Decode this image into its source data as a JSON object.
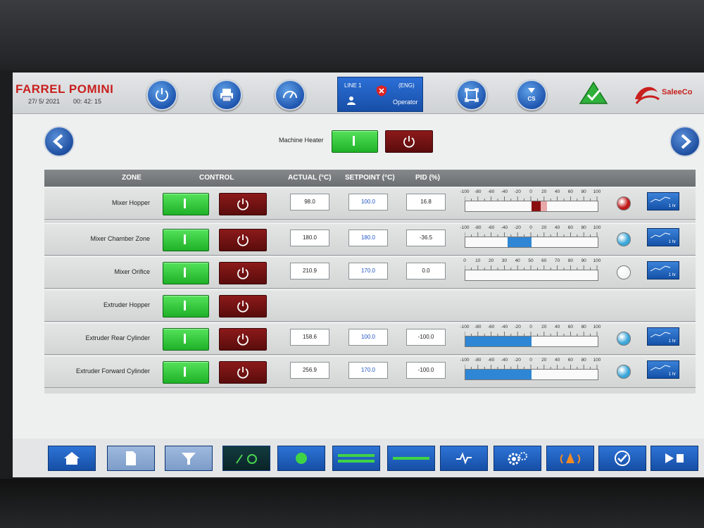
{
  "header": {
    "brand": "FARREL POMINI",
    "date": "27/ 5/ 2021",
    "time": "00: 42: 15",
    "user_panel": {
      "line": "LINE 1",
      "language": "(ENG)",
      "role": "Operator"
    },
    "logo_text": "SaleeCo"
  },
  "heater": {
    "label": "Machine Heater"
  },
  "table": {
    "headers": {
      "zone": "ZONE",
      "control": "CONTROL",
      "actual": "ACTUAL (°C)",
      "setpoint": "SETPOINT (°C)",
      "pid": "PID (%)"
    },
    "rows": [
      {
        "zone": "Mixer Hopper",
        "actual": "98.0",
        "setpoint": "100.0",
        "pid": "16.8",
        "scale_labels": [
          "-100",
          "-80",
          "-60",
          "-40",
          "-20",
          "0",
          "20",
          "40",
          "60",
          "80",
          "100"
        ],
        "scale_min": -100,
        "scale_max": 100,
        "bar_value": 16.8,
        "bar_color": "#8a1010",
        "indicator_color": "#c01818"
      },
      {
        "zone": "Mixer Chamber Zone",
        "actual": "180.0",
        "setpoint": "180.0",
        "pid": "-36.5",
        "scale_labels": [
          "-100",
          "-80",
          "-60",
          "-40",
          "-20",
          "0",
          "20",
          "40",
          "60",
          "80",
          "100"
        ],
        "scale_min": -100,
        "scale_max": 100,
        "bar_value": -36.5,
        "bar_color": "#2f86d4",
        "indicator_color": "#3aa6d8"
      },
      {
        "zone": "Mixer Orifice",
        "actual": "210.9",
        "setpoint": "170.0",
        "pid": "0.0",
        "scale_labels": [
          "0",
          "10",
          "20",
          "30",
          "40",
          "50",
          "60",
          "70",
          "80",
          "90",
          "100"
        ],
        "scale_min": 0,
        "scale_max": 100,
        "bar_value": 0.0,
        "bar_color": "#2f86d4",
        "indicator_color": "#f4f4f4"
      },
      {
        "zone": "Extruder Hopper"
      },
      {
        "zone": "Extruder Rear Cylinder",
        "actual": "158.6",
        "setpoint": "100.0",
        "pid": "-100.0",
        "scale_labels": [
          "-100",
          "-80",
          "-60",
          "-40",
          "-20",
          "0",
          "20",
          "40",
          "60",
          "80",
          "100"
        ],
        "scale_min": -100,
        "scale_max": 100,
        "bar_value": -100,
        "bar_color": "#2f86d4",
        "indicator_color": "#3aa6d8"
      },
      {
        "zone": "Extruder Forward Cylinder",
        "actual": "256.9",
        "setpoint": "170.0",
        "pid": "-100.0",
        "scale_labels": [
          "-100",
          "-80",
          "-60",
          "-40",
          "-20",
          "0",
          "20",
          "40",
          "60",
          "80",
          "100"
        ],
        "scale_min": -100,
        "scale_max": 100,
        "bar_value": -100,
        "bar_color": "#2f86d4",
        "indicator_color": "#3aa6d8"
      }
    ],
    "trend_label": "1 hr"
  },
  "icons": {
    "header": [
      "power-icon",
      "printer-icon",
      "speedometer-icon",
      "maximize-icon",
      "hourglass-cs-icon",
      "alarm-ok-triangle-icon"
    ],
    "bottom": [
      "home-icon",
      "document-icon",
      "hopper-icon",
      "recipe-icon",
      "green-dot-icon",
      "green-bars-icon",
      "green-line-icon",
      "trend-icon",
      "gears-icon",
      "alarm-bell-icon",
      "checkmark-icon",
      "play-icon"
    ]
  },
  "colors": {
    "accent_blue": "#1f56b0",
    "on_green": "#1fb128",
    "off_red": "#6b1212",
    "brand_red": "#c8201e"
  }
}
